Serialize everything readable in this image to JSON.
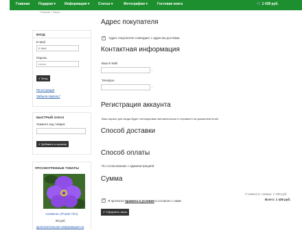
{
  "nav": {
    "items": [
      "Главная",
      "Подарки ▾",
      "Информация ▾",
      "Статьи ▾",
      "Фотографии ▾",
      "Гостевая книга"
    ],
    "cart": "1 438 руб."
  },
  "breadcrumbs": "Главная › Заказ",
  "login": {
    "title": "ВХОД",
    "email_label": "E-Mail",
    "email_value": "E-Mail",
    "password_label": "Пароль",
    "password_value": "••••••••",
    "login_button": "✔ Вход",
    "register_link": "Регистрация",
    "forgot_link": "Забыли пароль?"
  },
  "quick_order": {
    "title": "БЫСТРЫЙ ЗАКАЗ",
    "hint": "Укажите код товара:",
    "add_button": "✔ Добавить в корзину"
  },
  "viewed": {
    "title": "ПРОСМОТРЕННЫЕ ТОВАРЫ",
    "product_name": "Ахименес (Purple Cho)",
    "price": "50 руб.",
    "more_link": "Дополнительная информация на"
  },
  "main": {
    "buyer_address_title": "Адрес покупателя",
    "same_address_label": "Адрес покупателя совпадает с адресом доставки.",
    "contact_title": "Контактная информация",
    "email_label": "Ваш E-Mail",
    "phone_label": "Телефон",
    "account_title": "Регистрация аккаунта",
    "account_note": "Ваш пароль для входа будет сгенерирован автоматически и отправлен на указанный email.",
    "shipping_title": "Способ доставки",
    "payment_title": "Способ оплаты",
    "payment_note": "По согласованию с администрацией",
    "total_title": "Сумма",
    "subtotal": "Стоимость товара: 1 438 руб.",
    "total": "Всего: 1 438 руб.",
    "agree_prefix": "Я прочитал",
    "agree_link": "правила и условия",
    "agree_suffix": "и согласен с ними",
    "submit_button": "✔ Оформить заказ"
  },
  "colors": {
    "nav_bg": "#1e8f2f",
    "dark_button": "#333333",
    "link": "#2a5fb0"
  }
}
